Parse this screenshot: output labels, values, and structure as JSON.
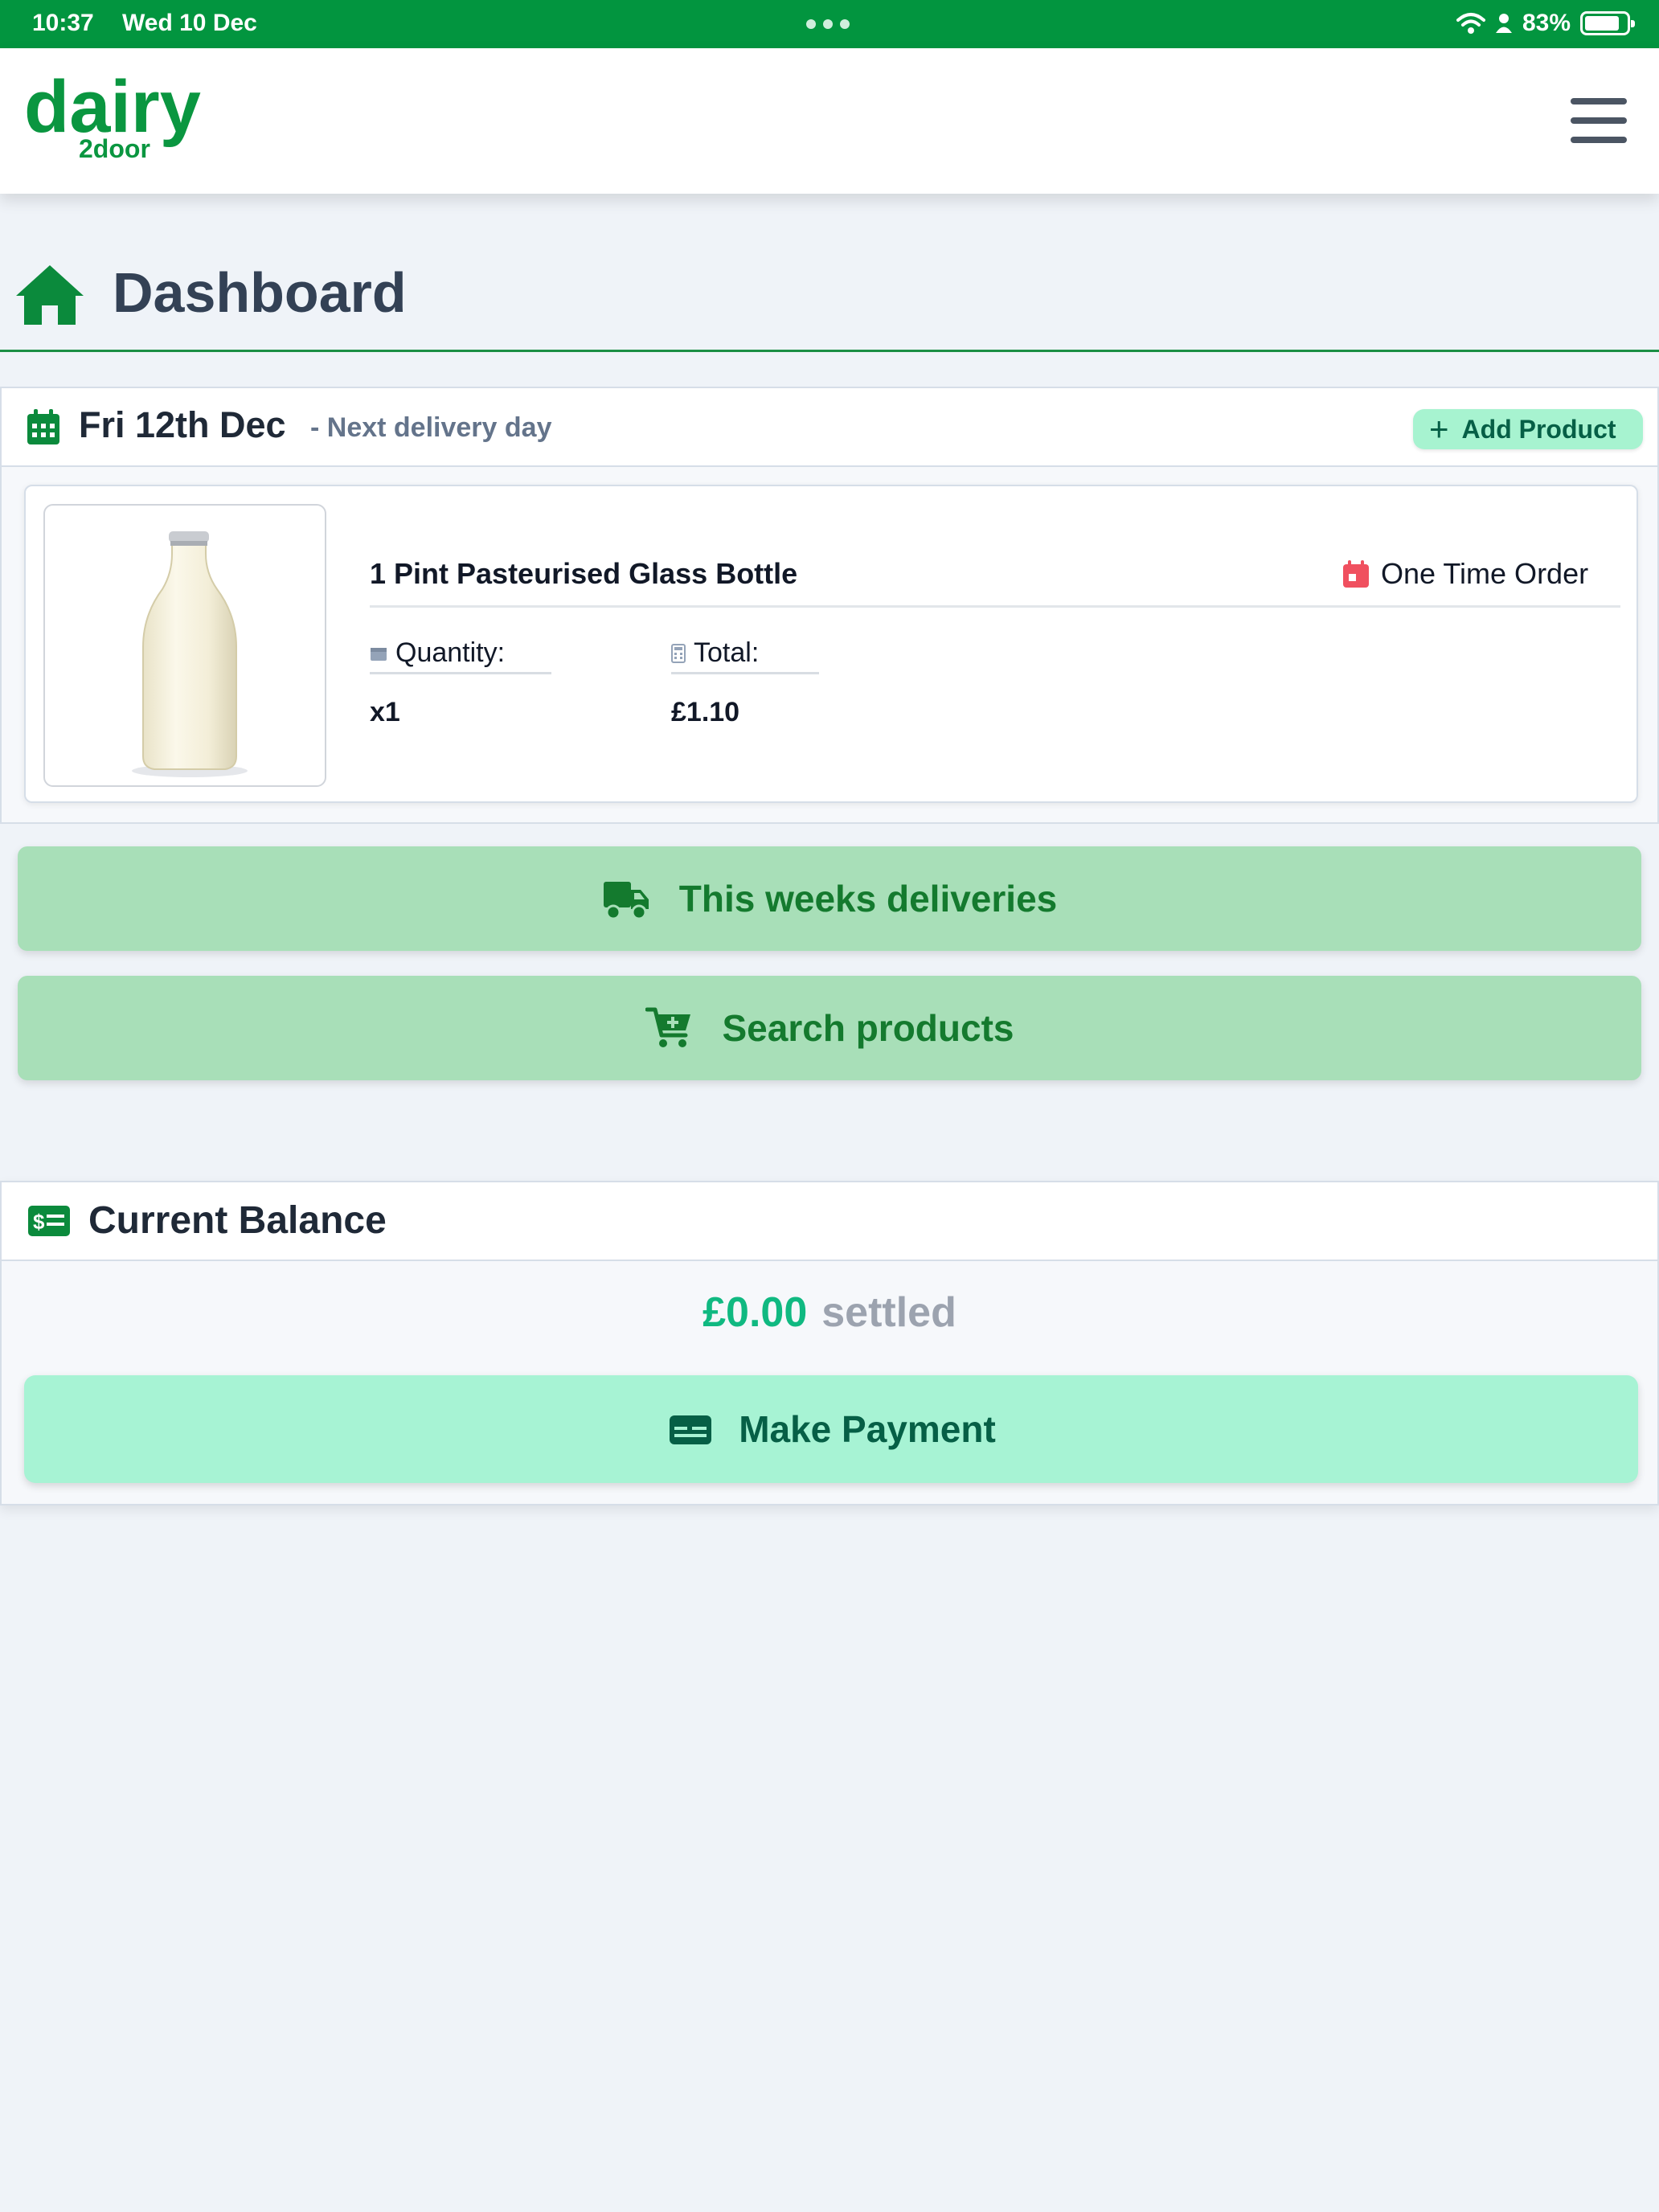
{
  "status_bar": {
    "time": "10:37",
    "date": "Wed 10 Dec",
    "battery": "83%",
    "battery_level": 0.83
  },
  "header": {
    "logo_main": "dairy",
    "logo_sub": "2door",
    "brand_color": "#0a9640"
  },
  "page": {
    "title": "Dashboard",
    "accent_color": "#1b8f45"
  },
  "delivery": {
    "date": "Fri 12th Dec",
    "subtitle": "- Next delivery day",
    "add_product_label": "Add Product",
    "items": [
      {
        "name": "1 Pint Pasteurised Glass Bottle",
        "order_type": "One Time Order",
        "quantity_label": "Quantity:",
        "quantity": "x1",
        "total_label": "Total:",
        "total": "£1.10",
        "image_icon": "milk-bottle-image"
      }
    ]
  },
  "actions": {
    "deliveries_label": "This weeks deliveries",
    "search_label": "Search products"
  },
  "balance": {
    "title": "Current Balance",
    "amount": "£0.00",
    "status": "settled",
    "pay_label": "Make Payment"
  }
}
